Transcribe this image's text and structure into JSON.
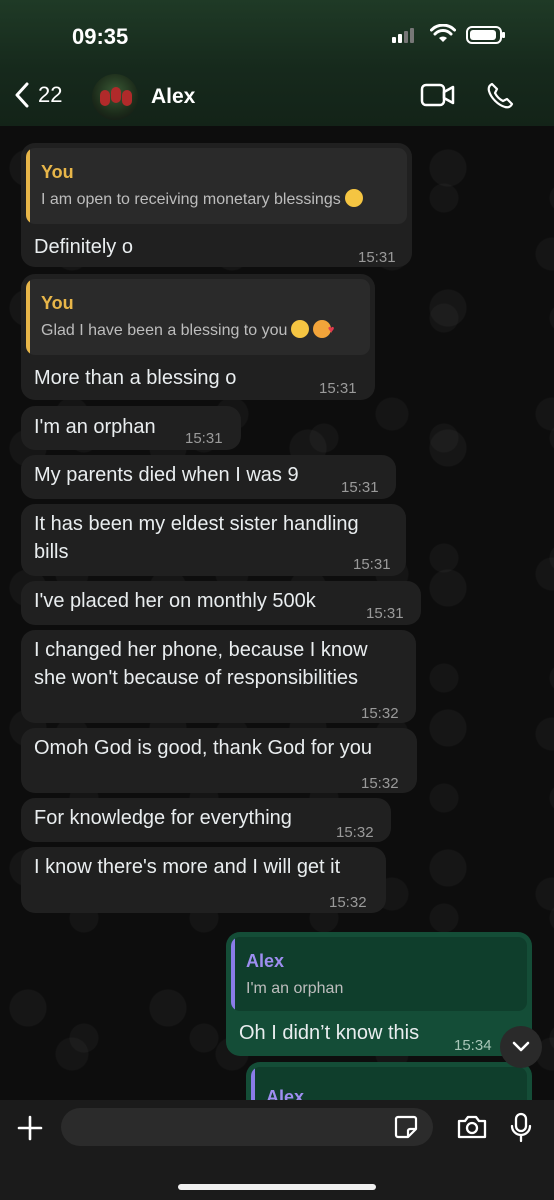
{
  "status_bar": {
    "time": "09:35"
  },
  "header": {
    "back_count": "22",
    "contact_name": "Alex"
  },
  "messages": [
    {
      "id": 1,
      "direction": "incoming",
      "quote": {
        "author": "You",
        "text": "I am open to receiving monetary blessings"
      },
      "text": "Definitely o",
      "time": "15:31"
    },
    {
      "id": 2,
      "direction": "incoming",
      "quote": {
        "author": "You",
        "text": "Glad I have been a blessing to you"
      },
      "text": "More than a blessing o",
      "time": "15:31"
    },
    {
      "id": 3,
      "direction": "incoming",
      "text": "I'm an orphan",
      "time": "15:31"
    },
    {
      "id": 4,
      "direction": "incoming",
      "text": "My parents died when I was 9",
      "time": "15:31"
    },
    {
      "id": 5,
      "direction": "incoming",
      "text_lines": [
        "It has been my eldest sister handling",
        "bills"
      ],
      "time": "15:31"
    },
    {
      "id": 6,
      "direction": "incoming",
      "text": "I've placed her on monthly 500k",
      "time": "15:31"
    },
    {
      "id": 7,
      "direction": "incoming",
      "text_lines": [
        "I changed her phone, because I know",
        "she won't because of responsibilities"
      ],
      "time": "15:32"
    },
    {
      "id": 8,
      "direction": "incoming",
      "text": "Omoh God is good, thank God for you",
      "time": "15:32"
    },
    {
      "id": 9,
      "direction": "incoming",
      "text": "For knowledge for everything",
      "time": "15:32"
    },
    {
      "id": 10,
      "direction": "incoming",
      "text": "I know there's more and I will get it",
      "time": "15:32"
    },
    {
      "id": 11,
      "direction": "outgoing",
      "quote": {
        "author": "Alex",
        "text": "I'm an orphan"
      },
      "text": "Oh I didn’t know this",
      "time": "15:34"
    },
    {
      "id": 12,
      "direction": "outgoing",
      "quote": {
        "author": "Alex",
        "text": ""
      },
      "text": "",
      "time": ""
    }
  ],
  "composer": {
    "placeholder": ""
  },
  "colors": {
    "header_bg": "#1f3a26",
    "incoming_bubble": "#202020",
    "outgoing_bubble": "#144d37",
    "quote_you": "#e8b649",
    "quote_alex": "#9d8ef0"
  },
  "icons": [
    "back-chevron-icon",
    "video-call-icon",
    "phone-icon",
    "chevron-down-icon",
    "plus-icon",
    "sticker-icon",
    "camera-icon",
    "microphone-icon"
  ]
}
